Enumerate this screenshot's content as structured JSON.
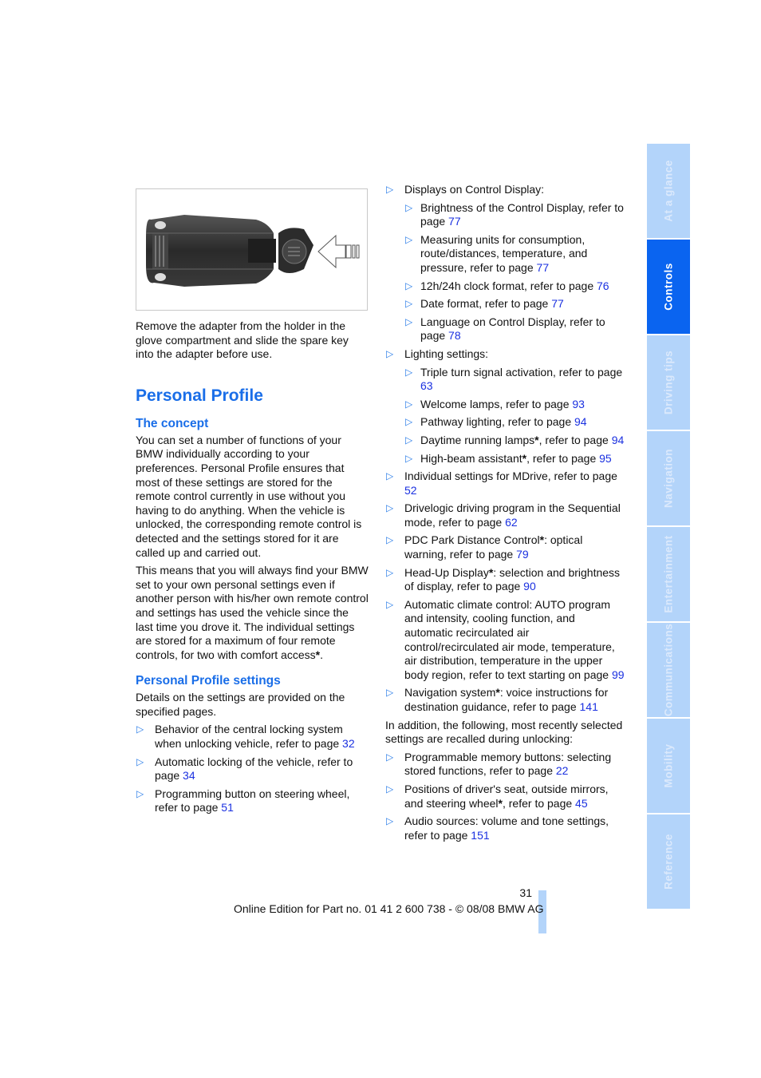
{
  "figure": {
    "alt": "Remote control key with spare key and insertion arrow",
    "code": "W8C9040"
  },
  "left": {
    "intro": "Remove the adapter from the holder in the glove compartment and slide the spare key into the adapter before use.",
    "title": "Personal Profile",
    "concept": {
      "heading": "The concept",
      "p1": "You can set a number of functions of your BMW individually according to your preferences. Personal Profile ensures that most of these settings are stored for the remote control currently in use without you having to do anything. When the vehicle is unlocked, the corresponding remote control is detected and the settings stored for it are called up and carried out.",
      "p2a": "This means that you will always find your BMW set to your own personal settings even if another person with his/her own remote control and settings has used the vehicle since the last time you drove it. The individual settings are stored for a maximum of four remote controls, for two with comfort access",
      "p2star": "*",
      "p2end": "."
    },
    "settings": {
      "heading": "Personal Profile settings",
      "intro": "Details on the settings are provided on the specified pages.",
      "items": [
        {
          "text": "Behavior of the central locking system when unlocking vehicle, refer to page ",
          "page": "32"
        },
        {
          "text": "Automatic locking of the vehicle, refer to page ",
          "page": "34"
        },
        {
          "text": "Programming button on steering wheel, refer to page ",
          "page": "51"
        }
      ]
    }
  },
  "right": {
    "displays": {
      "label": "Displays on Control Display:",
      "items": [
        {
          "text": "Brightness of the Control Display, refer to page ",
          "page": "77"
        },
        {
          "text": "Measuring units for consumption, route/distances, temperature, and pressure, refer to page ",
          "page": "77"
        },
        {
          "text": "12h/24h clock format, refer to page ",
          "page": "76"
        },
        {
          "text": "Date format, refer to page ",
          "page": "77"
        },
        {
          "text": "Language on Control Display, refer to page ",
          "page": "78"
        }
      ]
    },
    "lighting": {
      "label": "Lighting settings:",
      "items": [
        {
          "text": "Triple turn signal activation, refer to page ",
          "page": "63"
        },
        {
          "text": "Welcome lamps, refer to page ",
          "page": "93"
        },
        {
          "text": "Pathway lighting, refer to page ",
          "page": "94"
        },
        {
          "pre": "Daytime running lamps",
          "star": "*",
          "text": ", refer to page ",
          "page": "94"
        },
        {
          "pre": "High-beam assistant",
          "star": "*",
          "text": ", refer to page ",
          "page": "95"
        }
      ]
    },
    "items": [
      {
        "text": "Individual settings for MDrive, refer to page ",
        "page": "52"
      },
      {
        "text": "Drivelogic driving program in the Sequential mode, refer to page ",
        "page": "62"
      },
      {
        "pre": "PDC Park Distance Control",
        "star": "*",
        "text": ": optical warning, refer to page ",
        "page": "79"
      },
      {
        "pre": "Head-Up Display",
        "star": "*",
        "text": ": selection and brightness of display, refer to page ",
        "page": "90"
      },
      {
        "text": "Automatic climate control: AUTO program and intensity, cooling function, and automatic recirculated air control/recirculated air mode, temperature, air distribution, temperature in the upper body region, refer to text starting on page ",
        "page": "99"
      },
      {
        "pre": "Navigation system",
        "star": "*",
        "text": ": voice instructions for destination guidance, refer to page ",
        "page": "141"
      }
    ],
    "addition": "In addition, the following, most recently selected settings are recalled during unlocking:",
    "recalled": [
      {
        "text": "Programmable memory buttons: selecting stored functions, refer to page ",
        "page": "22"
      },
      {
        "pre": "Positions of driver's seat, outside mirrors, and steering wheel",
        "star": "*",
        "text": ", refer to page ",
        "page": "45"
      },
      {
        "text": "Audio sources: volume and tone settings, refer to page ",
        "page": "151"
      }
    ]
  },
  "tabs": [
    {
      "label": "At a glance",
      "active": false
    },
    {
      "label": "Controls",
      "active": true
    },
    {
      "label": "Driving tips",
      "active": false
    },
    {
      "label": "Navigation",
      "active": false
    },
    {
      "label": "Entertainment",
      "active": false
    },
    {
      "label": "Communications",
      "active": false
    },
    {
      "label": "Mobility",
      "active": false
    },
    {
      "label": "Reference",
      "active": false
    }
  ],
  "footer": {
    "page_number": "31",
    "text": "Online Edition for Part no. 01 41 2 600 738 - © 08/08 BMW AG"
  },
  "colors": {
    "heading": "#1a6ee8",
    "link": "#1a30e0",
    "tab_active": "#0a64f0",
    "tab_inactive": "#b3d4fa"
  }
}
